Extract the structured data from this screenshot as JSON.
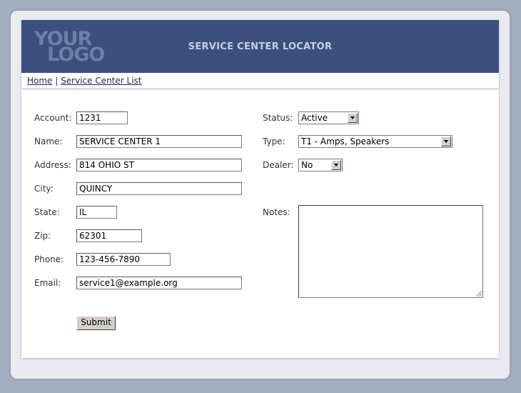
{
  "header": {
    "logo_line1": "YOUR",
    "logo_line2": "LOGO",
    "title": "SERVICE CENTER LOCATOR"
  },
  "breadcrumb": {
    "home": "Home",
    "separator": "|",
    "list": "Service Center List"
  },
  "form": {
    "account": {
      "label": "Account:",
      "value": "1231"
    },
    "name": {
      "label": "Name:",
      "value": "SERVICE CENTER 1"
    },
    "address": {
      "label": "Address:",
      "value": "814 OHIO ST"
    },
    "city": {
      "label": "City:",
      "value": "QUINCY"
    },
    "state": {
      "label": "State:",
      "value": "IL"
    },
    "zip": {
      "label": "Zip:",
      "value": "62301"
    },
    "phone": {
      "label": "Phone:",
      "value": "123-456-7890"
    },
    "email": {
      "label": "Email:",
      "value": "service1@example.org"
    },
    "status": {
      "label": "Status:",
      "value": "Active"
    },
    "type": {
      "label": "Type:",
      "value": "T1 - Amps, Speakers"
    },
    "dealer": {
      "label": "Dealer:",
      "value": "No"
    },
    "notes": {
      "label": "Notes:",
      "value": ""
    },
    "submit_label": "Submit"
  },
  "colors": {
    "header_bg": "#3c5080",
    "page_bg": "#a3adc0",
    "link": "#1d2a4a"
  },
  "icons": {
    "select_arrow": "chevron-down-icon",
    "resize_grip": "resize-grip-icon"
  }
}
